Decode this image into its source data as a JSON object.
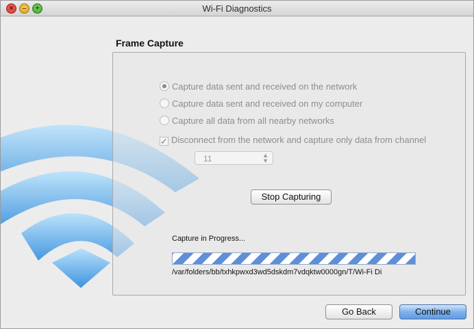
{
  "window": {
    "title": "Wi-Fi Diagnostics",
    "controls": {
      "close": "×",
      "minimize": "–",
      "zoom": "+"
    }
  },
  "section": {
    "title": "Frame Capture"
  },
  "options": {
    "radio1": "Capture data sent and received on the network",
    "radio2": "Capture data sent and received on my computer",
    "radio3": "Capture all data from all nearby networks",
    "checkbox": "Disconnect from the network and capture only data from channel",
    "selected_option": "radio1",
    "checkbox_checked": true
  },
  "channel_select": {
    "value": "11"
  },
  "buttons": {
    "stop_capturing": "Stop Capturing",
    "go_back": "Go Back",
    "continue": "Continue"
  },
  "progress": {
    "label": "Capture in Progress...",
    "indeterminate": true,
    "path": "/var/folders/bb/txhkpwxd3wd5dskdm7vdqktw0000gn/T/Wi-Fi Di"
  },
  "icons": {
    "background": "wifi-signal-icon"
  },
  "colors": {
    "accent": "#5f9be4",
    "wifi": "#4aa3e8",
    "progress_stripe": "#5f8fd6"
  }
}
